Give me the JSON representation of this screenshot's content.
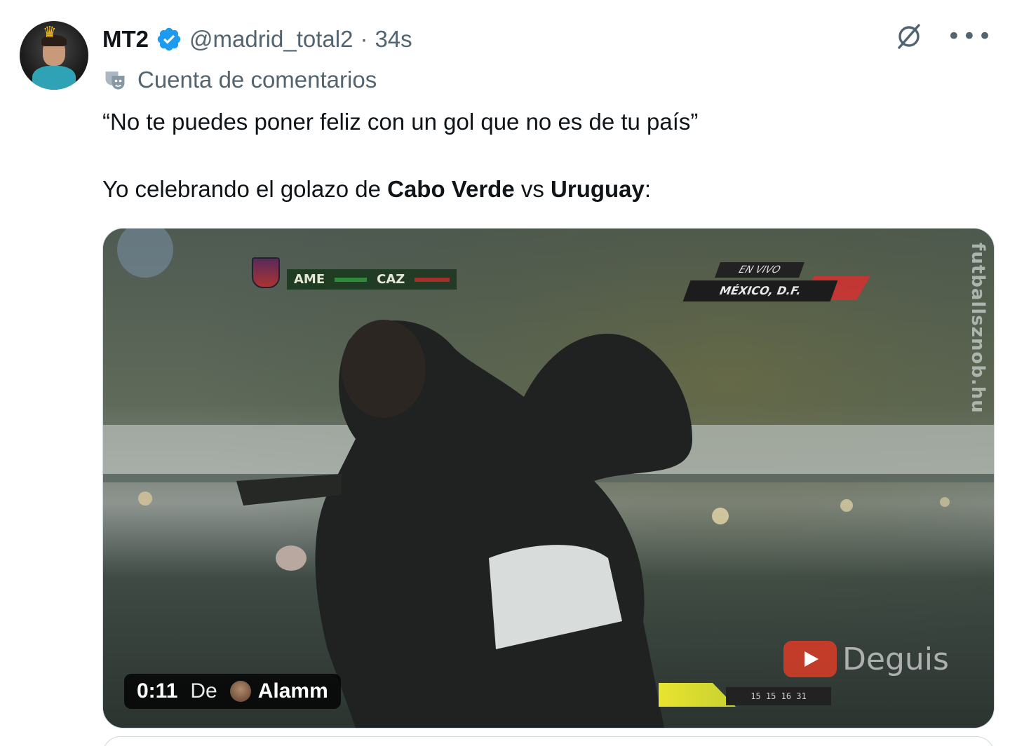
{
  "author": {
    "display_name": "MT2",
    "handle": "@madrid_total2",
    "separator": "·",
    "time": "34s",
    "verified_color": "#1d9bf0"
  },
  "account_label": "Cuenta de comentarios",
  "tweet": {
    "line1": "“No te puedes poner feliz con un gol que no es de tu país”",
    "line2_pre": "Yo celebrando el golazo de ",
    "line2_bold1": "Cabo Verde",
    "line2_mid": " vs ",
    "line2_bold2": "Uruguay",
    "line2_post": ":"
  },
  "media": {
    "scoreboard": {
      "home": "AME",
      "away": "CAZ"
    },
    "live": {
      "top": "EN VIVO",
      "bottom": "MÉXICO, D.F."
    },
    "vertical_watermark": "futballsznob.hu",
    "channel_watermark": "Deguis",
    "bottom_ticker": "15 15 16 31",
    "video_badge": {
      "timecode": "0:11",
      "from_label": "De",
      "source_name": "Alamm"
    }
  },
  "icons": {
    "grok": "grok-icon",
    "more": "more-icon",
    "mask": "mask-icon"
  }
}
